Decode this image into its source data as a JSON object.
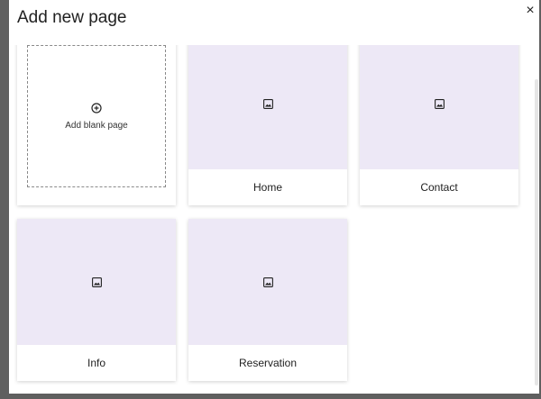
{
  "dialog": {
    "title": "Add new page",
    "close_symbol": "×"
  },
  "blank_card": {
    "label": "Add blank page",
    "icon": "plus-circle-icon"
  },
  "pages": [
    {
      "label": "Home",
      "icon": "image-icon"
    },
    {
      "label": "Contact",
      "icon": "image-icon"
    },
    {
      "label": "Info",
      "icon": "image-icon"
    },
    {
      "label": "Reservation",
      "icon": "image-icon"
    }
  ],
  "colors": {
    "preview_bg": "#ede8f6",
    "backdrop": "#5f5f5f"
  }
}
